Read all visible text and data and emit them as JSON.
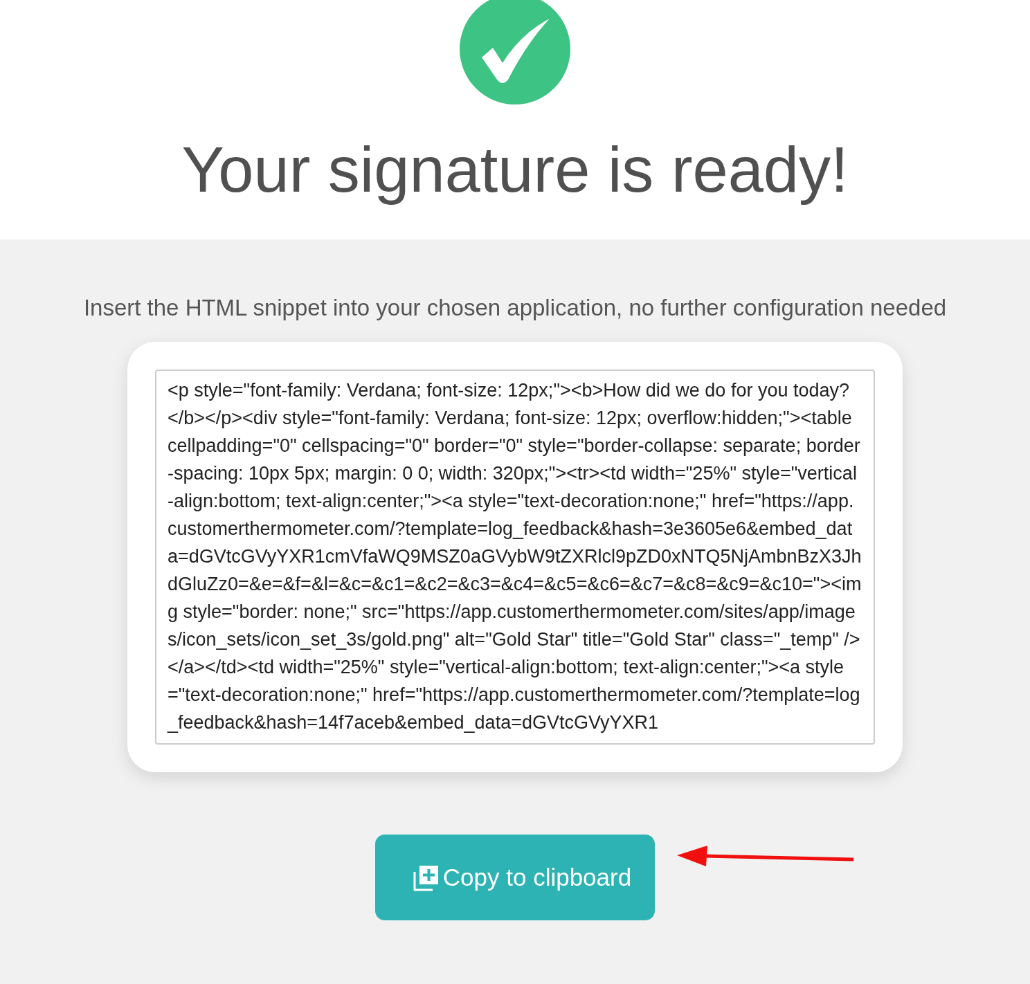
{
  "header": {
    "title": "Your signature is ready!"
  },
  "instructions": "Insert the HTML snippet into your chosen application, no further configuration needed",
  "snippet": {
    "value": "<p style=\"font-family: Verdana; font-size: 12px;\"><b>How did we do for you today?</b></p><div style=\"font-family: Verdana; font-size: 12px; overflow:hidden;\"><table cellpadding=\"0\" cellspacing=\"0\" border=\"0\" style=\"border-collapse: separate; border-spacing: 10px 5px; margin: 0 0; width: 320px;\"><tr><td width=\"25%\" style=\"vertical-align:bottom; text-align:center;\"><a style=\"text-decoration:none;\" href=\"https://app.customerthermometer.com/?template=log_feedback&hash=3e3605e6&embed_data=dGVtcGVyYXR1cmVfaWQ9MSZ0aGVybW9tZXRlcl9pZD0xNTQ5NjAmbnBzX3JhdGluZz0=&e=&f=&l=&c=&c1=&c2=&c3=&c4=&c5=&c6=&c7=&c8=&c9=&c10=\"><img style=\"border: none;\" src=\"https://app.customerthermometer.com/sites/app/images/icon_sets/icon_set_3s/gold.png\" alt=\"Gold Star\" title=\"Gold Star\" class=\"_temp\" /></a></td><td width=\"25%\" style=\"vertical-align:bottom; text-align:center;\"><a style=\"text-decoration:none;\" href=\"https://app.customerthermometer.com/?template=log_feedback&hash=14f7aceb&embed_data=dGVtcGVyYXR1"
  },
  "copy_button": {
    "label": "Copy to clipboard"
  }
}
